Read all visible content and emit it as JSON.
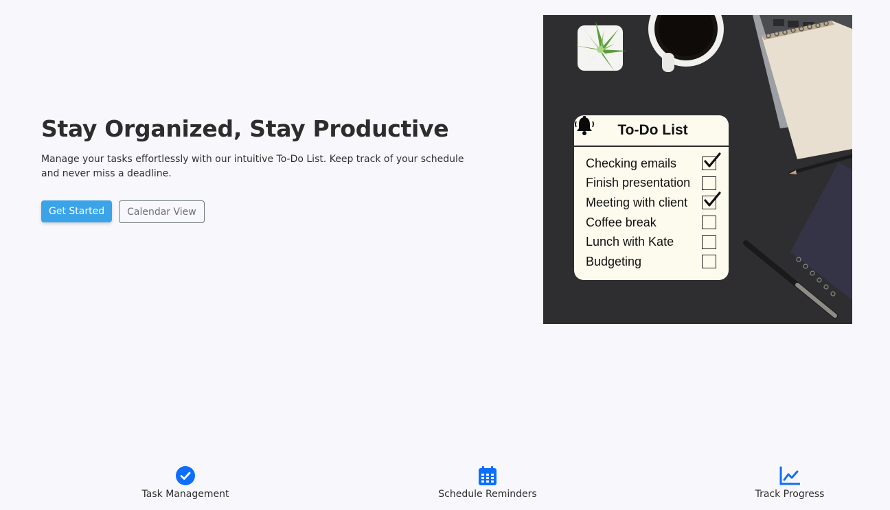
{
  "hero": {
    "title": "Stay Organized, Stay Productive",
    "description": "Manage your tasks effortlessly with our intuitive To-Do List. Keep track of your schedule and never miss a deadline.",
    "primary_button": "Get Started",
    "secondary_button": "Calendar View"
  },
  "todo_image": {
    "title": "To-Do List",
    "items": [
      {
        "label": "Checking emails",
        "checked": true
      },
      {
        "label": "Finish presentation",
        "checked": false
      },
      {
        "label": "Meeting with client",
        "checked": true
      },
      {
        "label": "Coffee break",
        "checked": false
      },
      {
        "label": "Lunch with Kate",
        "checked": false
      },
      {
        "label": "Budgeting",
        "checked": false
      }
    ]
  },
  "features": [
    {
      "label": "Task Management",
      "icon": "check-circle-icon"
    },
    {
      "label": "Schedule Reminders",
      "icon": "calendar-icon"
    },
    {
      "label": "Track Progress",
      "icon": "chart-line-icon"
    }
  ],
  "colors": {
    "accent": "#3ba3e8",
    "icon_blue": "#0d6efd",
    "background": "#f8f8fc"
  }
}
